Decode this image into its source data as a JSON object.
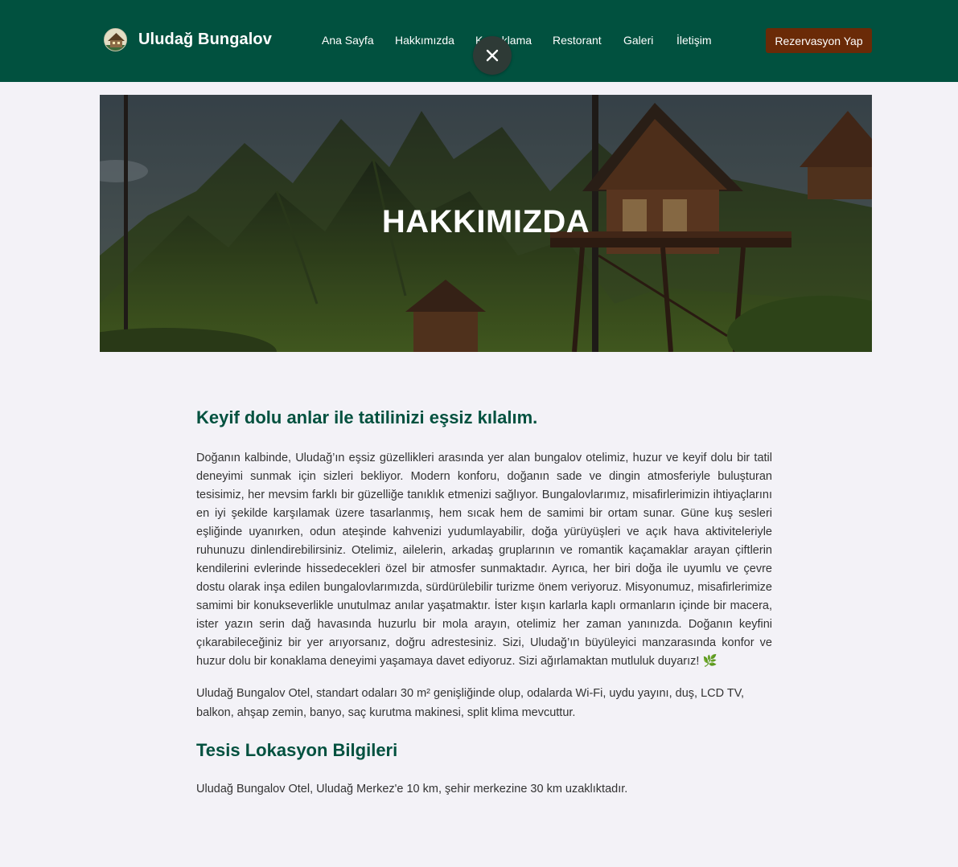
{
  "header": {
    "brand_name": "Uludağ Bungalov",
    "nav": [
      "Ana Sayfa",
      "Hakkımızda",
      "Konaklama",
      "Restorant",
      "Galeri",
      "İletişim"
    ],
    "cta_label": "Rezervasyon Yap",
    "close_symbol": "✕"
  },
  "hero": {
    "title": "HAKKIMIZDA"
  },
  "main": {
    "heading": "Keyif dolu anlar ile tatilinizi eşsiz kılalım.",
    "paragraph_1": "Doğanın kalbinde, Uludağ’ın eşsiz güzellikleri arasında yer alan bungalov otelimiz, huzur ve keyif dolu bir tatil deneyimi sunmak için sizleri bekliyor. Modern konforu, doğanın sade ve dingin atmosferiyle buluşturan tesisimiz, her mevsim farklı bir güzelliğe tanıklık etmenizi sağlıyor. Bungalovlarımız, misafirlerimizin ihtiyaçlarını en iyi şekilde karşılamak üzere tasarlanmış, hem sıcak hem de samimi bir ortam sunar. Güne kuş sesleri eşliğinde uyanırken, odun ateşinde kahvenizi yudumlayabilir, doğa yürüyüşleri ve açık hava aktiviteleriyle ruhunuzu dinlendirebilirsiniz. Otelimiz, ailelerin, arkadaş gruplarının ve romantik kaçamaklar arayan çiftlerin kendilerini evlerinde hissedecekleri özel bir atmosfer sunmaktadır. Ayrıca, her biri doğa ile uyumlu ve çevre dostu olarak inşa edilen bungalovlarımızda, sürdürülebilir turizme önem veriyoruz. Misyonumuz, misafirlerimize samimi bir konukseverlikle unutulmaz anılar yaşatmaktır. İster kışın karlarla kaplı ormanların içinde bir macera, ister yazın serin dağ havasında huzurlu bir mola arayın, otelimiz her zaman yanınızda. Doğanın keyfini çıkarabileceğiniz bir yer arıyorsanız, doğru adrestesiniz. Sizi, Uludağ’ın büyüleyici manzarasında konfor ve huzur dolu bir konaklama deneyimi yaşamaya davet ediyoruz. Sizi ağırlamaktan mutluluk duyarız!",
    "paragraph_1_emoji": "🌿",
    "paragraph_2": "Uludağ Bungalov Otel, standart odaları 30 m² genişliğinde olup, odalarda Wi-Fi, uydu yayını, duş, LCD TV, balkon, ahşap zemin, banyo, saç kurutma makinesi, split klima mevcuttur.",
    "location_heading": "Tesis Lokasyon Bilgileri",
    "location_text": "Uludağ Bungalov Otel, Uludağ Merkez'e 10 km, şehir merkezine 30 km uzaklıktadır."
  },
  "colors": {
    "header_bg": "#01513f",
    "cta_bg": "#6a2a07",
    "heading_color": "#01513f",
    "page_bg": "#f3f2f7"
  }
}
